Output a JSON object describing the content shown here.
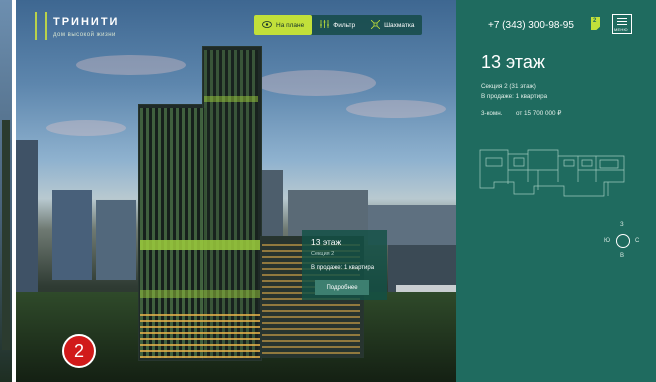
{
  "logo": {
    "name": "ТРИНИТИ",
    "subtitle": "дом высокой жизни"
  },
  "nav": {
    "items": [
      {
        "label": "На плане",
        "icon": "eye-icon",
        "active": true
      },
      {
        "label": "Фильтр",
        "icon": "filter-icon",
        "active": false
      },
      {
        "label": "Шахматка",
        "icon": "grid-icon",
        "active": false
      }
    ]
  },
  "header": {
    "phone": "+7 (343) 300-98-95",
    "doc_badge": "2",
    "menu_label": "МЕНЮ"
  },
  "floor": {
    "title": "13 этаж",
    "section": "Секция 2 (31 этаж)",
    "on_sale": "В продаже: 1 квартира",
    "apartment_type": "3-комн.",
    "price": "от 15 700 000 ₽"
  },
  "compass": {
    "n": "З",
    "w": "Ю",
    "e": "С",
    "s": "В"
  },
  "popup": {
    "title": "13 этаж",
    "section": "Секция 2",
    "on_sale": "В продаже: 1 квартира",
    "button": "Подробнее"
  },
  "annotation": {
    "number": "2"
  },
  "colors": {
    "panel": "#1f6b5f",
    "accent": "#c2e03a",
    "badge": "#d11a1a"
  }
}
